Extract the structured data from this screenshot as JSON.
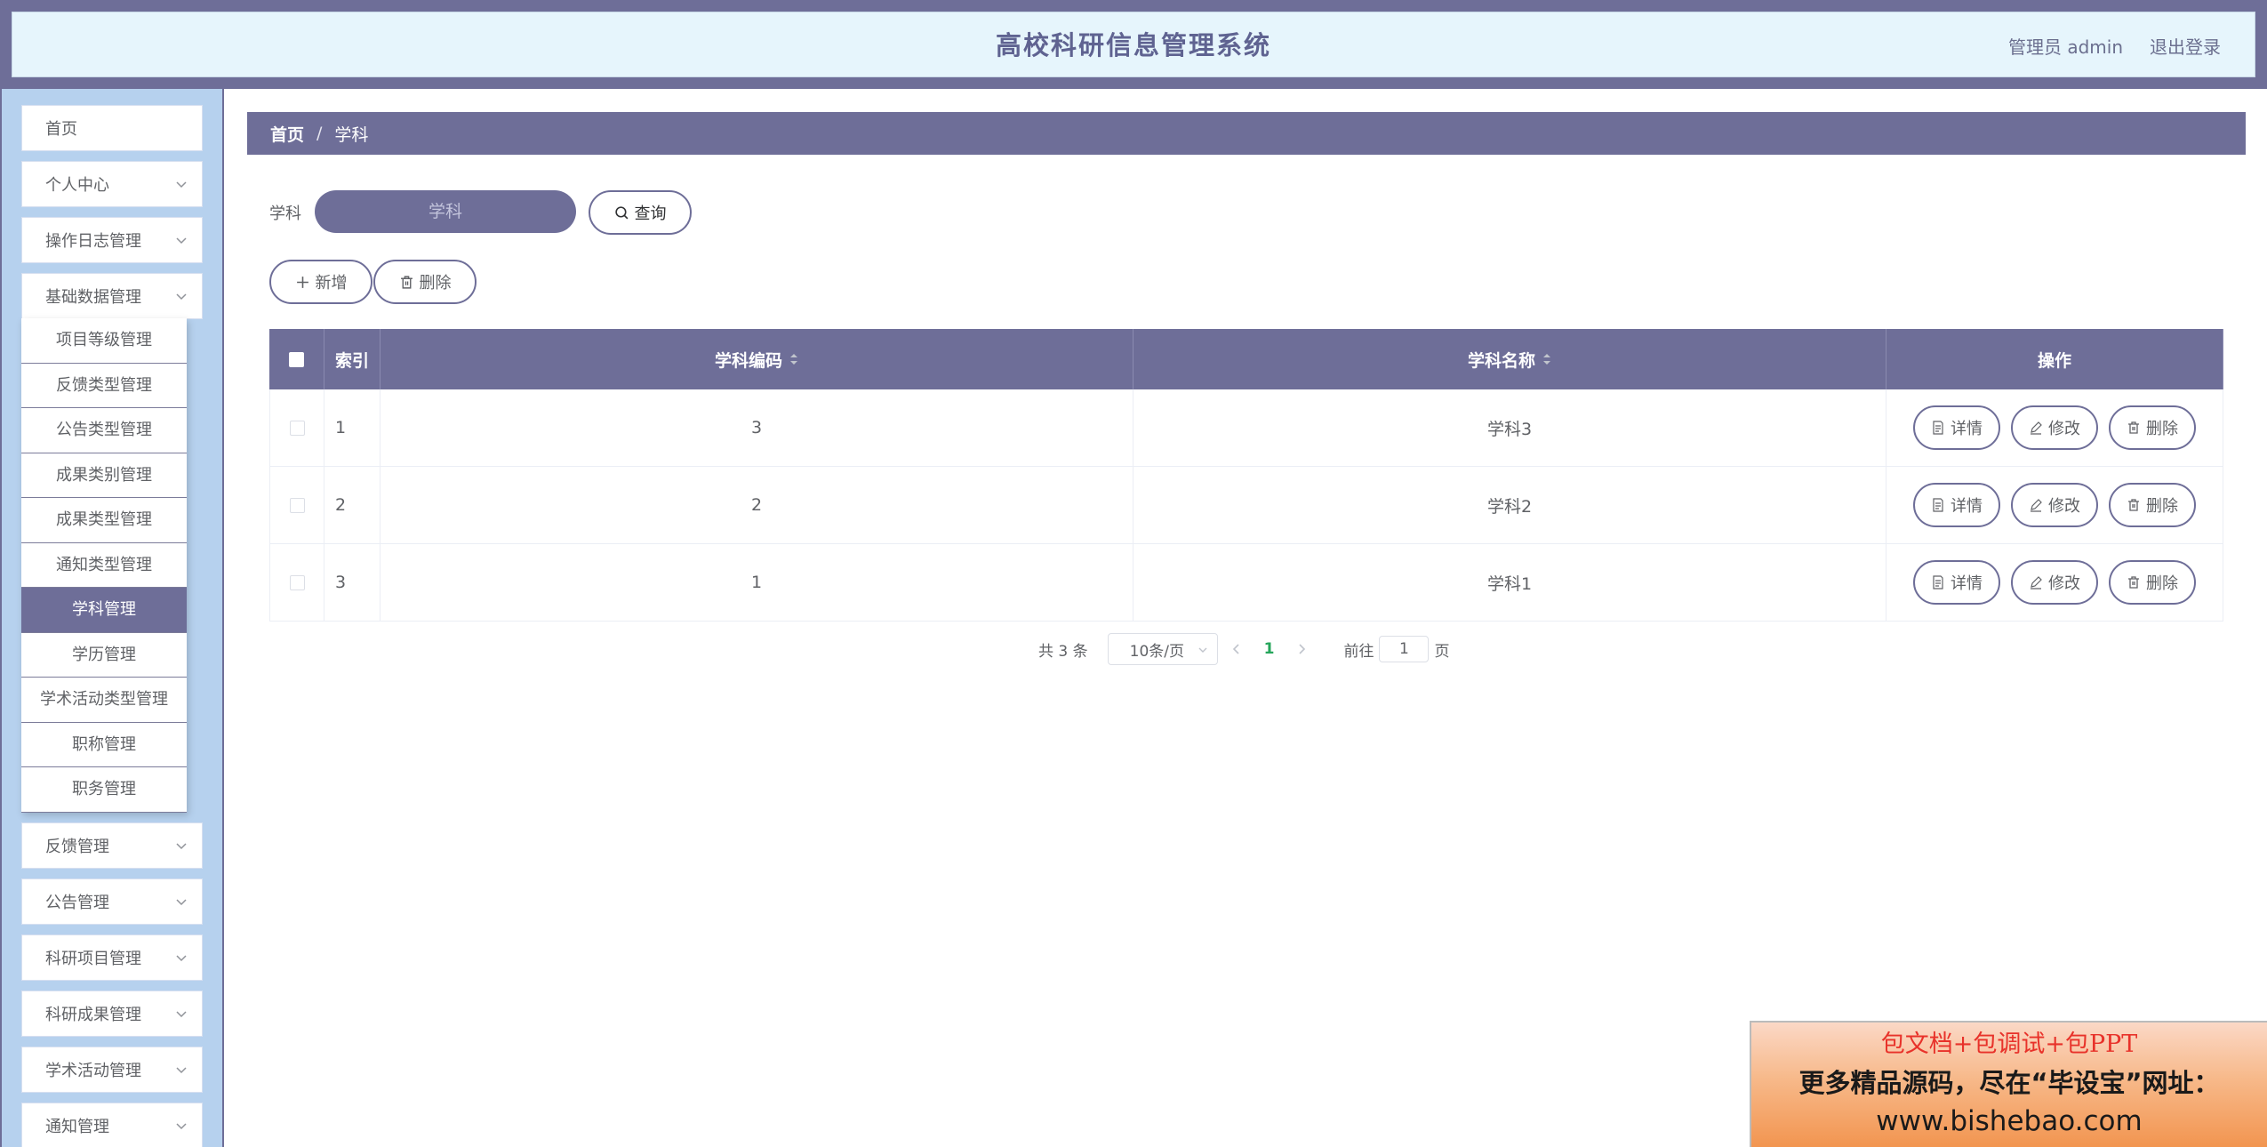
{
  "header": {
    "title": "高校科研信息管理系统",
    "user_label": "管理员 admin",
    "logout_label": "退出登录"
  },
  "sidebar": {
    "items": [
      {
        "label": "首页",
        "has_arrow": false
      },
      {
        "label": "个人中心",
        "has_arrow": true
      },
      {
        "label": "操作日志管理",
        "has_arrow": true
      },
      {
        "label": "基础数据管理",
        "has_arrow": true
      },
      {
        "label": "反馈管理",
        "has_arrow": true
      },
      {
        "label": "公告管理",
        "has_arrow": true
      },
      {
        "label": "科研项目管理",
        "has_arrow": true
      },
      {
        "label": "科研成果管理",
        "has_arrow": true
      },
      {
        "label": "学术活动管理",
        "has_arrow": true
      },
      {
        "label": "通知管理",
        "has_arrow": true
      }
    ],
    "submenu": [
      "项目等级管理",
      "反馈类型管理",
      "公告类型管理",
      "成果类别管理",
      "成果类型管理",
      "通知类型管理",
      "学科管理",
      "学历管理",
      "学术活动类型管理",
      "职称管理",
      "职务管理"
    ],
    "active_submenu": "学科管理"
  },
  "breadcrumb": {
    "home": "首页",
    "separator": "/",
    "current": "学科"
  },
  "filter": {
    "label": "学科",
    "placeholder": "学科",
    "search_button": "查询"
  },
  "toolbar": {
    "add_label": "新增",
    "delete_label": "删除"
  },
  "table": {
    "headers": {
      "index": "索引",
      "code": "学科编码",
      "name": "学科名称",
      "ops": "操作"
    },
    "rows": [
      {
        "index": "1",
        "code": "3",
        "name": "学科3"
      },
      {
        "index": "2",
        "code": "2",
        "name": "学科2"
      },
      {
        "index": "3",
        "code": "1",
        "name": "学科1"
      }
    ],
    "row_actions": {
      "detail": "详情",
      "edit": "修改",
      "delete": "删除"
    }
  },
  "pagination": {
    "total_text": "共 3 条",
    "page_size": "10条/页",
    "current_page": "1",
    "goto_prefix": "前往",
    "goto_value": "1",
    "goto_suffix": "页"
  },
  "ad": {
    "line1": "包文档+包调试+包PPT",
    "line2": "更多精品源码，尽在“毕设宝”网址：",
    "line3": "www.bishebao.com"
  },
  "colors": {
    "accent": "#6e6e98",
    "sidebar_bg": "#b6d1ee",
    "header_bg": "#e6f5fc",
    "page_active": "#26a65b"
  }
}
